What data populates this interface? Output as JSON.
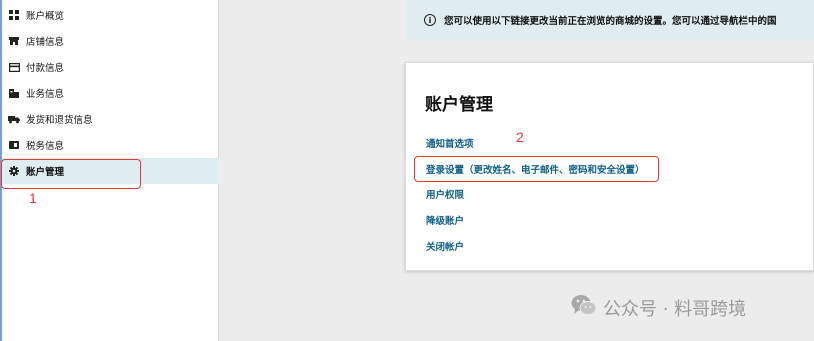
{
  "sidebar": {
    "items": [
      {
        "label": "账户概览",
        "icon": "dashboard-icon"
      },
      {
        "label": "店铺信息",
        "icon": "store-icon"
      },
      {
        "label": "付款信息",
        "icon": "credit-card-icon"
      },
      {
        "label": "业务信息",
        "icon": "building-icon"
      },
      {
        "label": "发货和退货信息",
        "icon": "truck-icon"
      },
      {
        "label": "税务信息",
        "icon": "tax-icon"
      },
      {
        "label": "账户管理",
        "icon": "gear-icon",
        "active": true
      }
    ]
  },
  "banner": {
    "text": "您可以使用以下链接更改当前正在浏览的商城的设置。您可以通过导航栏中的国"
  },
  "card": {
    "title": "账户管理",
    "links": [
      "通知首选项",
      "登录设置（更改姓名、电子邮件、密码和安全设置）",
      "用户权限",
      "降级账户",
      "关闭帐户"
    ]
  },
  "annotations": {
    "label_1": "1",
    "label_2": "2"
  },
  "watermark": {
    "text": "公众号 · 料哥跨境"
  },
  "colors": {
    "accent_link": "#11608a",
    "annotation_red": "#e53935",
    "active_bg": "#e0edf0",
    "banner_bg": "#e0edf0"
  }
}
